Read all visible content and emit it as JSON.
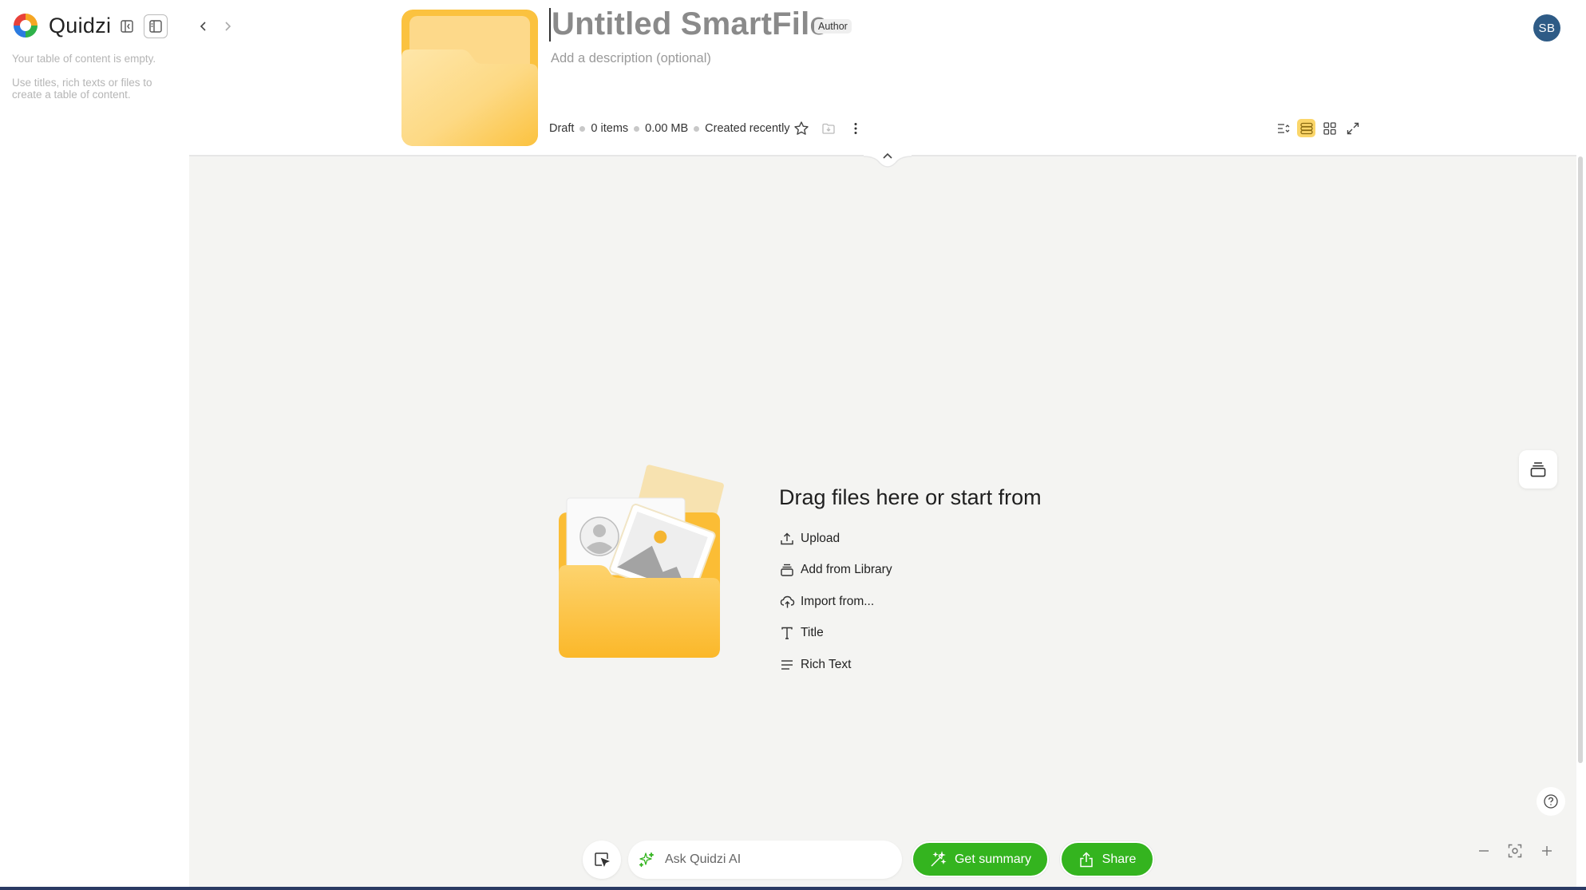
{
  "app": {
    "name": "Quidzi"
  },
  "sidebar": {
    "toc_empty_line1": "Your table of content is empty.",
    "toc_empty_line2": "Use titles, rich texts or files to create a table of content."
  },
  "header": {
    "title": "Untitled SmartFile",
    "role_badge": "Author",
    "description_placeholder": "Add a description (optional)",
    "status": "Draft",
    "items": "0 items",
    "size": "0.00 MB",
    "created": "Created recently",
    "avatar_initials": "SB"
  },
  "canvas": {
    "drop_title": "Drag files here or start from",
    "actions": [
      {
        "label": "Upload",
        "icon": "upload-icon"
      },
      {
        "label": "Add from Library",
        "icon": "library-icon"
      },
      {
        "label": "Import from...",
        "icon": "cloud-import-icon"
      },
      {
        "label": "Title",
        "icon": "title-icon"
      },
      {
        "label": "Rich Text",
        "icon": "rich-text-icon"
      }
    ]
  },
  "bottom_bar": {
    "ask_placeholder": "Ask Quidzi AI",
    "summary_label": "Get summary",
    "share_label": "Share"
  },
  "colors": {
    "accent_green": "#34b41f",
    "folder_yellow": "#fbbf3a",
    "avatar_blue": "#2e5b86"
  }
}
